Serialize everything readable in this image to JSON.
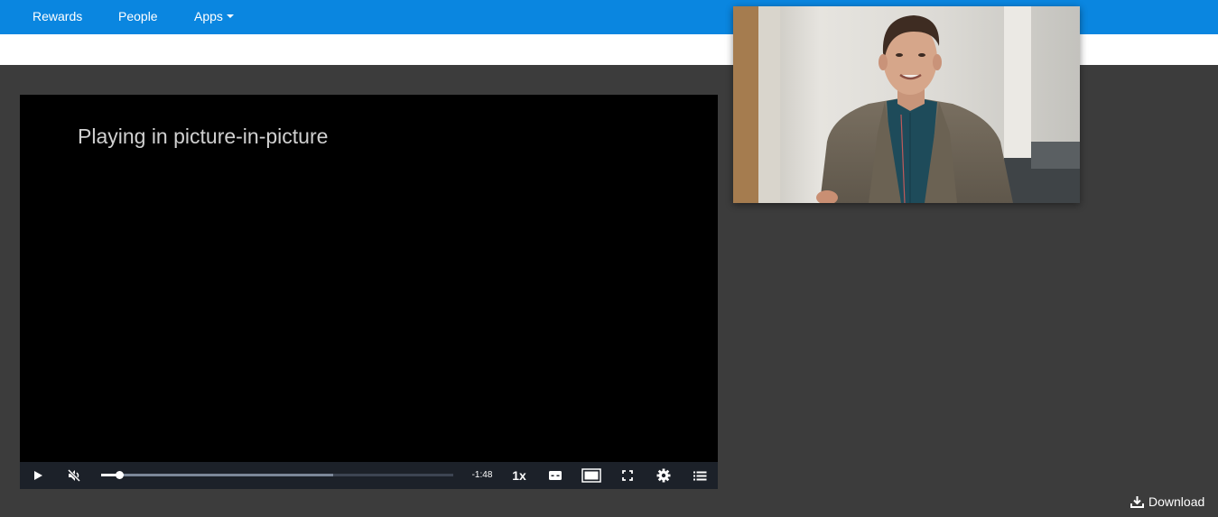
{
  "nav": {
    "items": [
      {
        "label": "Rewards"
      },
      {
        "label": "People"
      },
      {
        "label": "Apps"
      }
    ]
  },
  "player": {
    "pip_message": "Playing in picture-in-picture",
    "time_remaining": "-1:48",
    "playback_speed": "1x",
    "progress_played": 0.05,
    "progress_buffered": 0.66,
    "muted": true
  },
  "download": {
    "label": "Download"
  },
  "colors": {
    "nav_bar": "#0a86e0",
    "page_background": "#3c3c3c",
    "control_bar": "#1c2129"
  },
  "icons": [
    "play-icon",
    "mute-icon",
    "captions-icon",
    "theater-mode-icon",
    "fullscreen-icon",
    "settings-icon",
    "playlist-icon",
    "download-icon",
    "caret-down-icon"
  ]
}
